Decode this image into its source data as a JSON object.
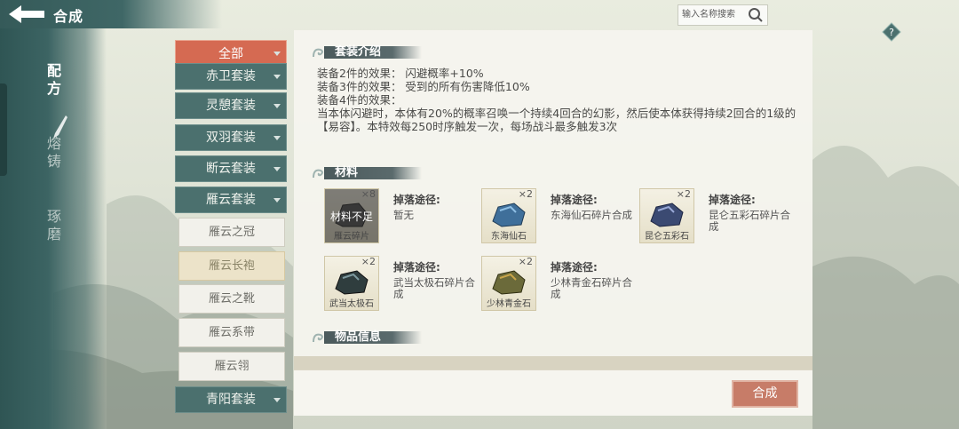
{
  "header": {
    "title": "合成",
    "back_icon": "back-arrow-icon"
  },
  "search": {
    "placeholder": "输入名称搜索",
    "icon": "search-icon"
  },
  "help": {
    "label": "?",
    "icon": "help-icon"
  },
  "leftnav": {
    "items": [
      {
        "label": "配方",
        "active": true
      },
      {
        "label": "熔铸",
        "active": false
      },
      {
        "label": "琢磨",
        "active": false
      }
    ]
  },
  "categories": [
    {
      "label": "全部",
      "selected": true
    },
    {
      "label": "赤卫套装",
      "selected": false
    },
    {
      "label": "灵憩套装",
      "selected": false
    },
    {
      "label": "双羽套装",
      "selected": false
    },
    {
      "label": "断云套装",
      "selected": false
    },
    {
      "label": "雁云套装",
      "selected": false,
      "expanded": true
    },
    {
      "label": "青阳套装",
      "selected": false
    }
  ],
  "subitems": [
    {
      "label": "雁云之冠",
      "selected": false
    },
    {
      "label": "雁云长袍",
      "selected": true
    },
    {
      "label": "雁云之靴",
      "selected": false
    },
    {
      "label": "雁云系带",
      "selected": false
    },
    {
      "label": "雁云翎",
      "selected": false
    }
  ],
  "set_intro": {
    "heading": "套装介绍",
    "line2": "装备2件的效果： 闪避概率+10%",
    "line3": "装备3件的效果： 受到的所有伤害降低10%",
    "line4": "装备4件的效果：",
    "desc": "当本体闪避时，本体有20%的概率召唤一个持续4回合的幻影，然后使本体获得持续2回合的1级的【易容】。本特效每250时序触发一次，每场战斗最多触发3次"
  },
  "materials": {
    "heading": "材料",
    "drop_label": "掉落途径:",
    "items": [
      {
        "name": "雁云碎片",
        "count": "×8",
        "status": "材料不足",
        "drop": "暂无",
        "color": "#4a4a4a"
      },
      {
        "name": "东海仙石",
        "count": "×2",
        "drop": "东海仙石碎片合成",
        "color": "#3f6f9a"
      },
      {
        "name": "昆仑五彩石",
        "count": "×2",
        "drop": "昆仑五彩石碎片合成",
        "color": "#3b4a72"
      },
      {
        "name": "武当太极石",
        "count": "×2",
        "drop": "武当太极石碎片合成",
        "color": "#2f3d3e"
      },
      {
        "name": "少林青金石",
        "count": "×2",
        "drop": "少林青金石碎片合成",
        "color": "#6b6a3a"
      }
    ]
  },
  "item_info": {
    "heading": "物品信息"
  },
  "actions": {
    "compose_label": "合成"
  }
}
